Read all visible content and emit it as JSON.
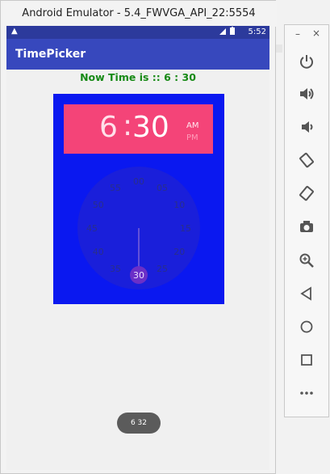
{
  "emulator": {
    "window_title": "Android Emulator - 5.4_FWVGA_API_22:5554"
  },
  "status_bar": {
    "time": "5:52",
    "warning_icon": "warning-icon",
    "signal_icon": "signal-icon",
    "battery_icon": "battery-icon"
  },
  "app": {
    "title": "TimePicker",
    "now_time_text": "Now Time is :: 6 : 30"
  },
  "time_picker": {
    "hour": "6",
    "separator": ":",
    "minute": "30",
    "am_label": "AM",
    "pm_label": "PM",
    "selected_period": "AM",
    "selected_minute": "30",
    "dial_labels": [
      "00",
      "05",
      "10",
      "15",
      "20",
      "25",
      "30",
      "35",
      "40",
      "45",
      "50",
      "55"
    ],
    "header_color": "#f44478",
    "background_color": "#0a18f0"
  },
  "toast": {
    "text": "6 32"
  },
  "side_toolbar": {
    "minimize": "–",
    "close": "×",
    "buttons": [
      {
        "name": "power-icon"
      },
      {
        "name": "volume-up-icon"
      },
      {
        "name": "volume-down-icon"
      },
      {
        "name": "rotate-left-icon"
      },
      {
        "name": "rotate-right-icon"
      },
      {
        "name": "camera-icon"
      },
      {
        "name": "zoom-icon"
      },
      {
        "name": "back-icon"
      },
      {
        "name": "home-icon"
      },
      {
        "name": "overview-icon"
      },
      {
        "name": "more-icon"
      }
    ]
  }
}
